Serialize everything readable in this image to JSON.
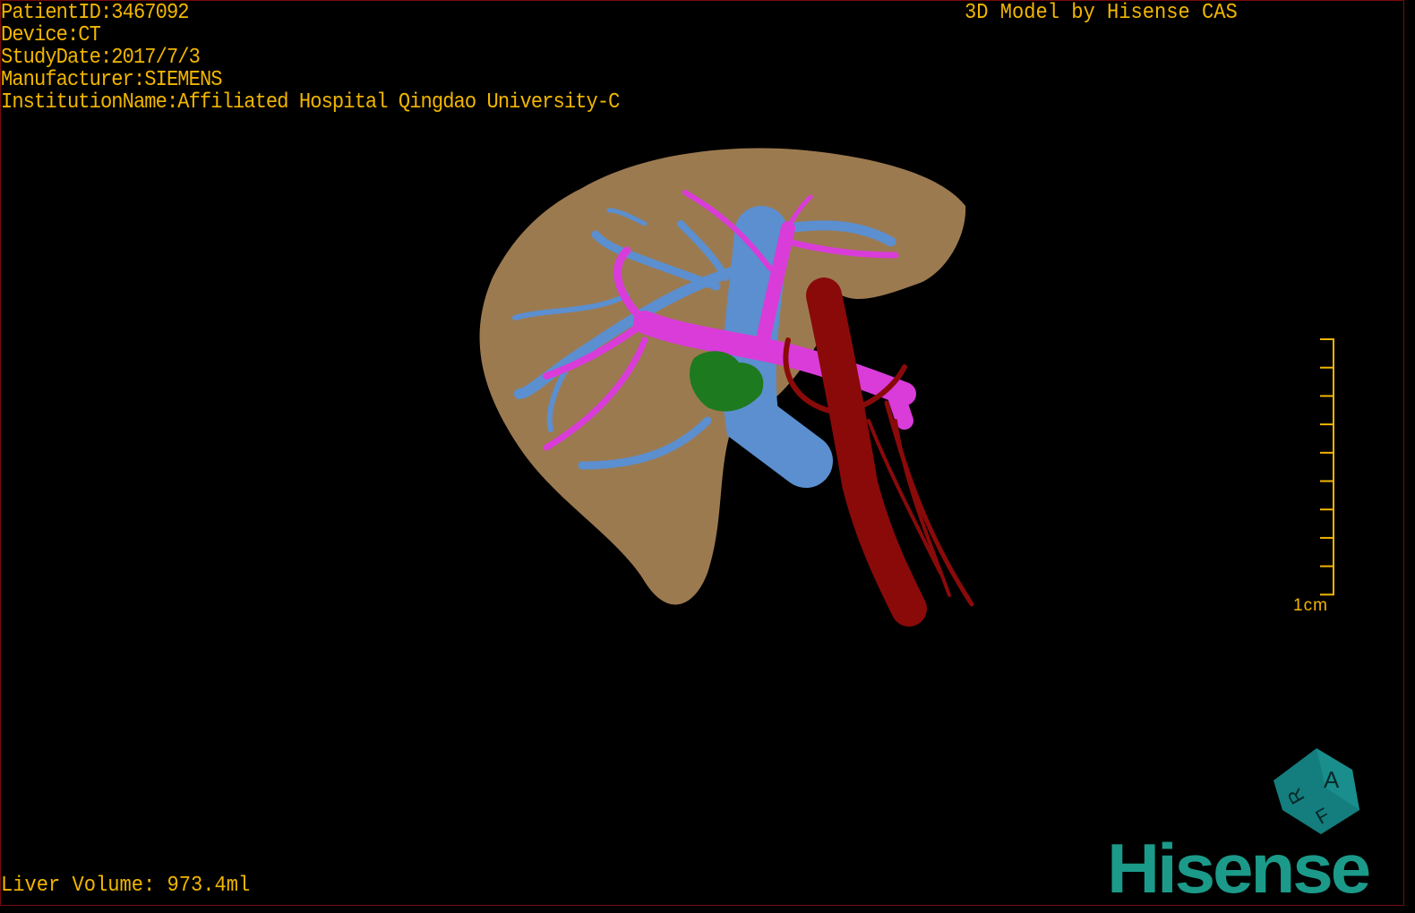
{
  "header": {
    "patient_id": "PatientID:3467092",
    "device": "Device:CT",
    "study_date": "StudyDate:2017/7/3",
    "manufacturer": "Manufacturer:SIEMENS",
    "institution": "InstitutionName:Affiliated Hospital Qingdao University-C",
    "title": "3D Model by Hisense CAS"
  },
  "footer": {
    "liver_volume": "Liver Volume: 973.4ml"
  },
  "scale_bar": {
    "label": "1cm"
  },
  "orientation_cube": {
    "faces": [
      "A",
      "F",
      "R"
    ]
  },
  "logo": {
    "text": "Hisense"
  },
  "colors": {
    "text": "#f2b600",
    "liver": "#9c7a50",
    "portal_vein": "#d93cd9",
    "hepatic_vein": "#5b8fd0",
    "artery": "#8a0a0a",
    "lesion": "#1e7a1e",
    "logo": "#1b9a8a"
  }
}
